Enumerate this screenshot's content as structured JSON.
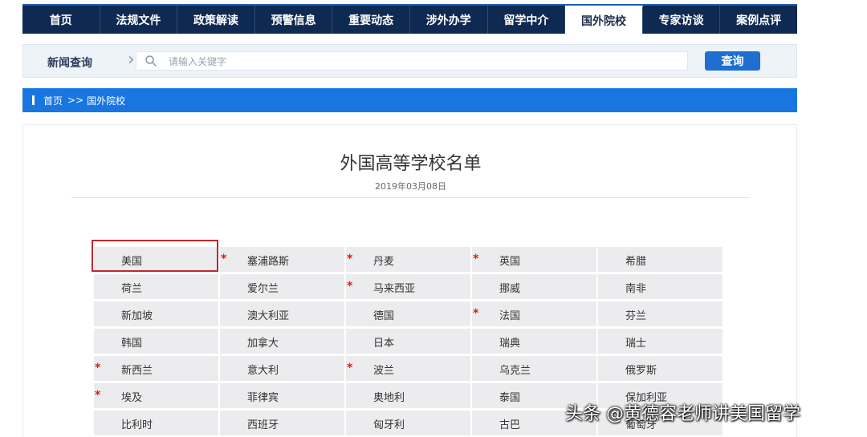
{
  "nav": {
    "items": [
      {
        "label": "首页"
      },
      {
        "label": "法规文件"
      },
      {
        "label": "政策解读"
      },
      {
        "label": "预警信息"
      },
      {
        "label": "重要动态"
      },
      {
        "label": "涉外办学"
      },
      {
        "label": "留学中介"
      },
      {
        "label": "国外院校"
      },
      {
        "label": "专家访谈"
      },
      {
        "label": "案例点评"
      }
    ],
    "active": "国外院校"
  },
  "search": {
    "label": "新闻查询",
    "placeholder": "请输入关键字",
    "button_label": "查询",
    "icon": "search-icon"
  },
  "breadcrumb": {
    "home": "首页",
    "separator": ">>",
    "current": "国外院校"
  },
  "article": {
    "title": "外国高等学校名单",
    "date": "2019年03月08日"
  },
  "countries": [
    {
      "name": "美国",
      "star": ""
    },
    {
      "name": "塞浦路斯",
      "star": "*"
    },
    {
      "name": "丹麦",
      "star": "*"
    },
    {
      "name": "英国",
      "star": "*"
    },
    {
      "name": "希腊",
      "star": ""
    },
    {
      "name": "荷兰",
      "star": ""
    },
    {
      "name": "爱尔兰",
      "star": ""
    },
    {
      "name": "马来西亚",
      "star": "*"
    },
    {
      "name": "挪威",
      "star": ""
    },
    {
      "name": "南非",
      "star": ""
    },
    {
      "name": "新加坡",
      "star": ""
    },
    {
      "name": "澳大利亚",
      "star": ""
    },
    {
      "name": "德国",
      "star": ""
    },
    {
      "name": "法国",
      "star": "*"
    },
    {
      "name": "芬兰",
      "star": ""
    },
    {
      "name": "韩国",
      "star": ""
    },
    {
      "name": "加拿大",
      "star": ""
    },
    {
      "name": "日本",
      "star": ""
    },
    {
      "name": "瑞典",
      "star": ""
    },
    {
      "name": "瑞士",
      "star": ""
    },
    {
      "name": "新西兰",
      "star": "*"
    },
    {
      "name": "意大利",
      "star": ""
    },
    {
      "name": "波兰",
      "star": "*"
    },
    {
      "name": "乌克兰",
      "star": ""
    },
    {
      "name": "俄罗斯",
      "star": ""
    },
    {
      "name": "埃及",
      "star": "*"
    },
    {
      "name": "菲律宾",
      "star": ""
    },
    {
      "name": "奥地利",
      "star": ""
    },
    {
      "name": "泰国",
      "star": ""
    },
    {
      "name": "保加利亚",
      "star": ""
    },
    {
      "name": "比利时",
      "star": ""
    },
    {
      "name": "西班牙",
      "star": ""
    },
    {
      "name": "匈牙利",
      "star": ""
    },
    {
      "name": "古巴",
      "star": ""
    },
    {
      "name": "葡萄牙",
      "star": ""
    }
  ],
  "highlighted_country": "美国",
  "watermark": "头条 @黄德容老师讲美国留学",
  "colors": {
    "nav_bg": "#0f2a52",
    "accent_blue": "#1976e0",
    "button_blue": "#1f6fd1",
    "star_red": "#e01919",
    "highlight_red": "#c0282e"
  }
}
